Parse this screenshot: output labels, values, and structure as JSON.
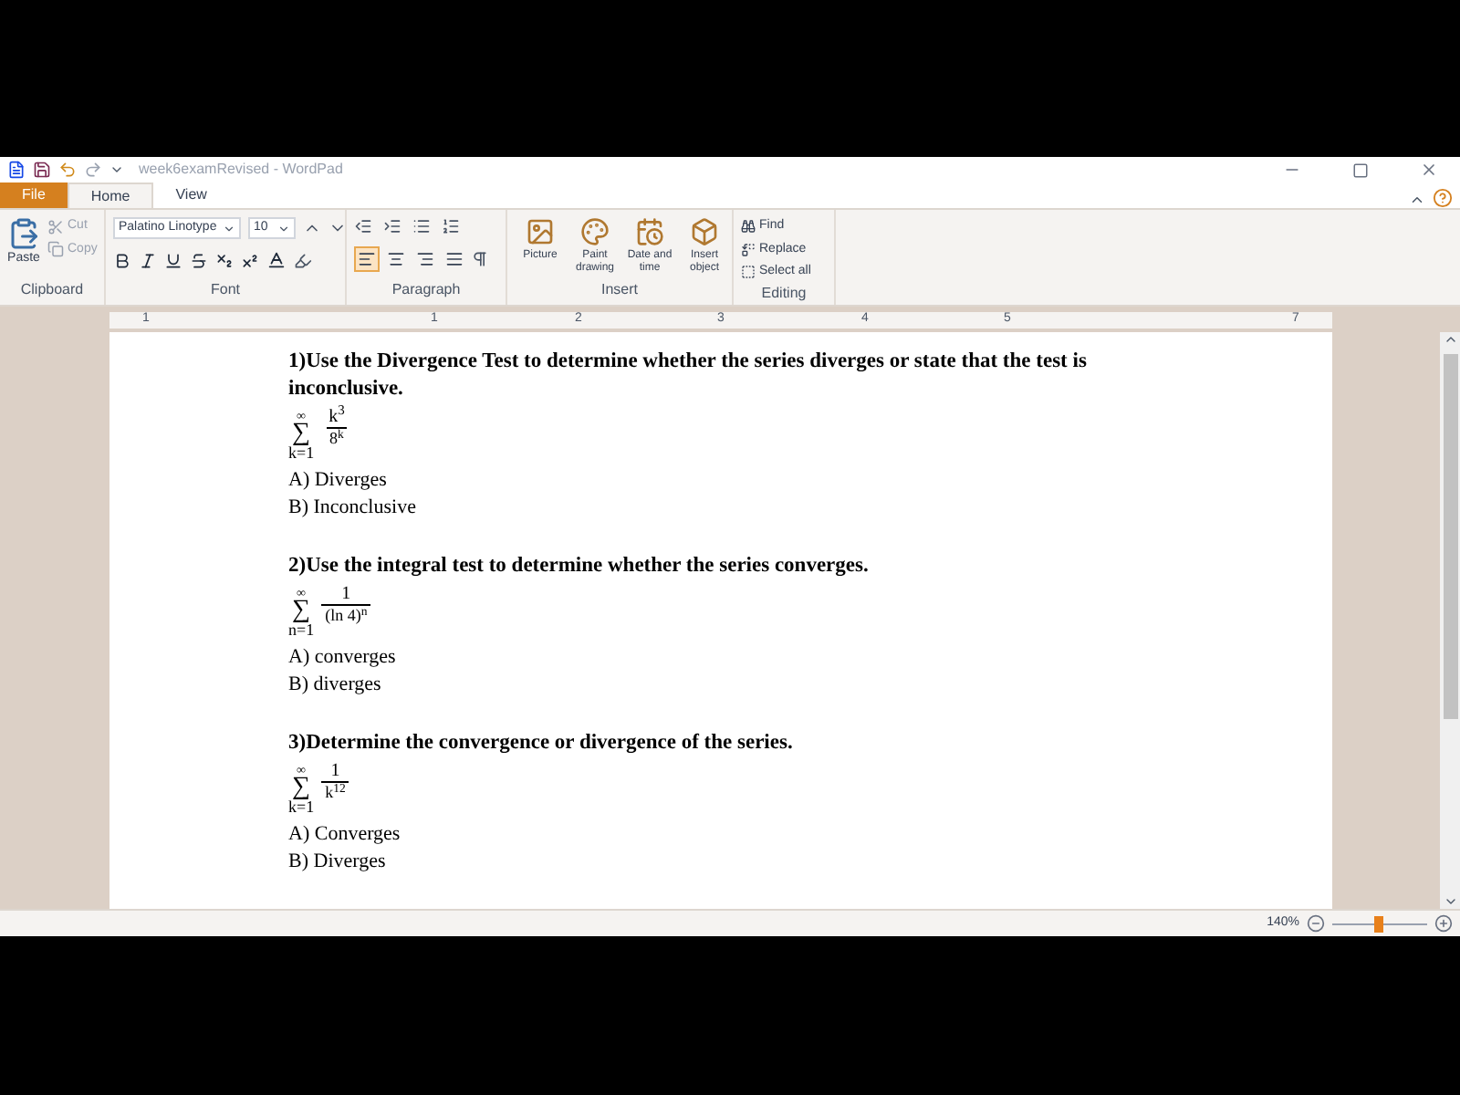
{
  "window": {
    "title": "week6examRevised - WordPad"
  },
  "tabs": [
    {
      "label": "File",
      "kind": "file",
      "selected": false
    },
    {
      "label": "Home",
      "kind": "tab",
      "selected": true
    },
    {
      "label": "View",
      "kind": "tab",
      "selected": false
    }
  ],
  "ribbon": {
    "clipboard": {
      "paste": "Paste",
      "cut": "Cut",
      "copy": "Copy",
      "label": "Clipboard"
    },
    "font": {
      "name": "Palatino Linotype",
      "size": "10",
      "label": "Font"
    },
    "paragraph": {
      "label": "Paragraph",
      "alignments": [
        {
          "selected": true
        },
        {
          "selected": false
        },
        {
          "selected": false
        },
        {
          "selected": false
        }
      ]
    },
    "insert": {
      "label": "Insert",
      "items": [
        "Picture",
        "Paint drawing",
        "Date and time",
        "Insert object"
      ]
    },
    "editing": {
      "label": "Editing",
      "items": [
        "Find",
        "Replace",
        "Select all"
      ]
    }
  },
  "ruler": {
    "labels": [
      "1",
      "1",
      "2",
      "3",
      "4",
      "5",
      "7"
    ]
  },
  "questions": [
    {
      "sigma": "∑",
      "prompt": "1)Use the Divergence Test to determine whether the series diverges or state that the test is inconclusive.",
      "upper": "∞",
      "lower": "k=1",
      "numerator": "k$^{3}$",
      "denominator": "8$^{k}$",
      "answers": [
        "A) Diverges",
        "B) Inconclusive"
      ]
    },
    {
      "sigma": "∑",
      "prompt": "2)Use the integral test to determine whether the series converges.",
      "upper": "∞",
      "lower": "n=1",
      "numerator": "1",
      "denominator": "(ln 4)$^{n}$",
      "answers": [
        "A) converges",
        "B) diverges"
      ]
    },
    {
      "sigma": "∑",
      "prompt": "3)Determine the convergence or divergence of the series.",
      "upper": "∞",
      "lower": "k=1",
      "numerator": "1",
      "denominator": "k$^{12}$",
      "answers": [
        "A) Converges",
        "B) Diverges"
      ]
    }
  ],
  "status_bar": {
    "zoom": "140%",
    "level": 0.48
  }
}
